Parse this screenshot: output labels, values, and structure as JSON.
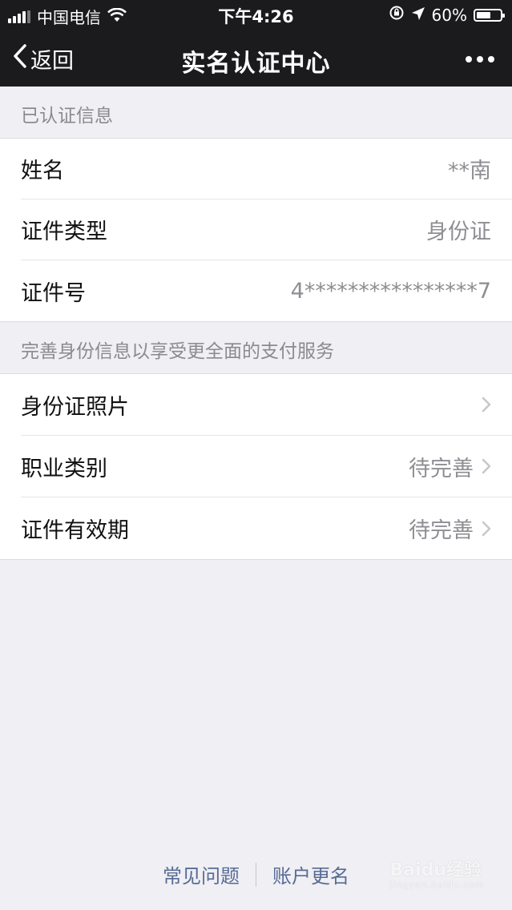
{
  "status_bar": {
    "carrier": "中国电信",
    "time": "下午4:26",
    "battery": "60%",
    "battery_level": 0.6
  },
  "nav": {
    "back_label": "返回",
    "title": "实名认证中心"
  },
  "section_verified": {
    "header": "已认证信息",
    "rows": [
      {
        "label": "姓名",
        "value": "**南"
      },
      {
        "label": "证件类型",
        "value": "身份证"
      },
      {
        "label": "证件号",
        "value": "4****************7"
      }
    ]
  },
  "section_improve": {
    "header": "完善身份信息以享受更全面的支付服务",
    "rows": [
      {
        "label": "身份证照片",
        "value": ""
      },
      {
        "label": "职业类别",
        "value": "待完善"
      },
      {
        "label": "证件有效期",
        "value": "待完善"
      }
    ]
  },
  "footer": {
    "faq": "常见问题",
    "rename": "账户更名"
  },
  "watermark": {
    "brand": "Baidu经验",
    "site": "jingyan.baidu.com"
  },
  "icons": {
    "back": "chevron-left-icon",
    "more": "more-dots-icon",
    "disclosure": "chevron-right-icon",
    "wifi": "wifi-icon",
    "location": "location-arrow-icon",
    "rotation_lock": "rotation-lock-icon"
  }
}
